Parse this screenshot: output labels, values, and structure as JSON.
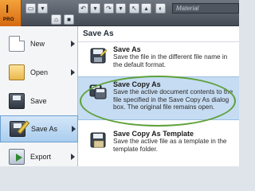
{
  "app": {
    "button_glyph": "I",
    "button_badge": "PRO"
  },
  "toolbar": {
    "material_value": "Material"
  },
  "left_menu": {
    "items": [
      {
        "label": "New",
        "icon": "new-document-icon"
      },
      {
        "label": "Open",
        "icon": "open-folder-icon"
      },
      {
        "label": "Save",
        "icon": "floppy-disk-icon"
      },
      {
        "label": "Save As",
        "icon": "save-as-icon"
      },
      {
        "label": "Export",
        "icon": "export-icon"
      }
    ],
    "selected": "Save As"
  },
  "submenu": {
    "title": "Save As",
    "entries": [
      {
        "title": "Save As",
        "description": "Save the file in the different file name in the default format."
      },
      {
        "title": "Save Copy As",
        "description": "Save the active document contents to the file specified in the Save Copy As dialog box. The original file remains open."
      },
      {
        "title": "Save Copy As Template",
        "description": "Save the active file as a template in the template folder."
      }
    ],
    "highlighted": "Save Copy As"
  },
  "colors": {
    "accent_orange": "#e0801e",
    "selection_blue": "#c6dcf2",
    "highlight_ellipse": "#5ea13a"
  }
}
